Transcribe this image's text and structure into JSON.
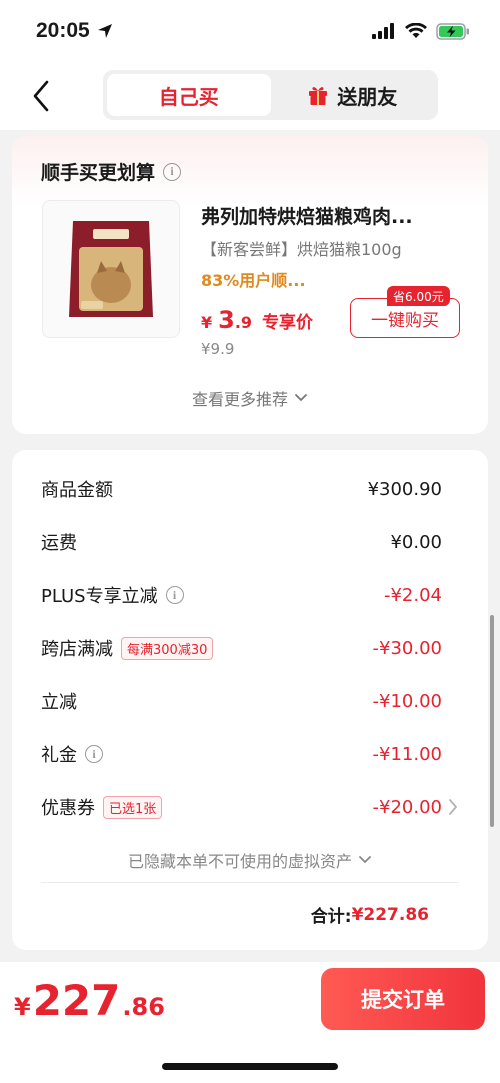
{
  "status": {
    "time": "20:05"
  },
  "header": {
    "tabs": [
      {
        "label": "自己买",
        "active": true
      },
      {
        "label": "送朋友",
        "active": false
      }
    ]
  },
  "recommend": {
    "title": "顺手买更划算",
    "product": {
      "name": "弗列加特烘焙猫粮鸡肉...",
      "subtitle": "【新客尝鲜】烘焙猫粮100g",
      "rating_text": "83%用户顺...",
      "price_yen": "¥",
      "price_int": "3",
      "price_dec": ".9",
      "price_tag": "专享价",
      "orig_price": "¥9.9",
      "save_badge": "省6.00元",
      "buy_label": "一键购买"
    },
    "more_label": "查看更多推荐"
  },
  "summary": {
    "rows": [
      {
        "label": "商品金额",
        "value": "¥300.90"
      },
      {
        "label": "运费",
        "value": "¥0.00"
      },
      {
        "label": "PLUS专享立减",
        "value": "-¥2.04"
      },
      {
        "label": "跨店满减",
        "tag": "每满300减30",
        "value": "-¥30.00"
      },
      {
        "label": "立减",
        "value": "-¥10.00"
      },
      {
        "label": "礼金",
        "value": "-¥11.00"
      },
      {
        "label": "优惠券",
        "tag": "已选1张",
        "value": "-¥20.00"
      }
    ],
    "hidden_assets_label": "已隐藏本单不可使用的虚拟资产",
    "total_label": "合计:",
    "total_value": "¥227.86"
  },
  "bottom": {
    "price_yen": "¥",
    "price_int": "227",
    "price_dec": ".86",
    "submit_label": "提交订单"
  },
  "colors": {
    "accent": "#e6232f",
    "orange": "#e08a1e"
  }
}
